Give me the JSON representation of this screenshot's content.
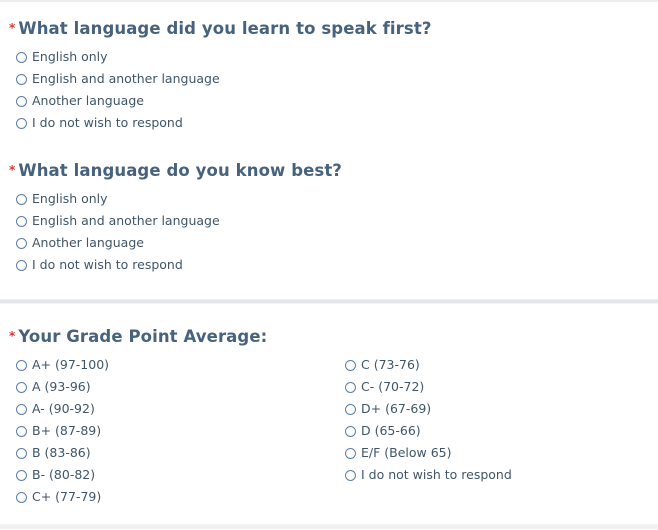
{
  "form": {
    "required_marker": "*",
    "questions": [
      {
        "id": "language-first",
        "title": "What language did you learn to speak first?",
        "options": [
          "English only",
          "English and another language",
          "Another language",
          "I do not wish to respond"
        ]
      },
      {
        "id": "language-best",
        "title": "What language do you know best?",
        "options": [
          "English only",
          "English and another language",
          "Another language",
          "I do not wish to respond"
        ]
      },
      {
        "id": "grade-point-average",
        "title": "Your Grade Point Average:",
        "options_left": [
          "A+ (97-100)",
          "A (93-96)",
          "A- (90-92)",
          "B+ (87-89)",
          "B (83-86)",
          "B- (80-82)",
          "C+ (77-79)"
        ],
        "options_right": [
          "C (73-76)",
          "C- (70-72)",
          "D+ (67-69)",
          "D (65-66)",
          "E/F (Below 65)",
          "I do not wish to respond"
        ]
      }
    ]
  },
  "colors": {
    "heading": "#46627c",
    "required": "#d9362b",
    "option_text": "#3f5668",
    "radio_border": "#5b7fa6",
    "separator": "#e2e5ea"
  }
}
